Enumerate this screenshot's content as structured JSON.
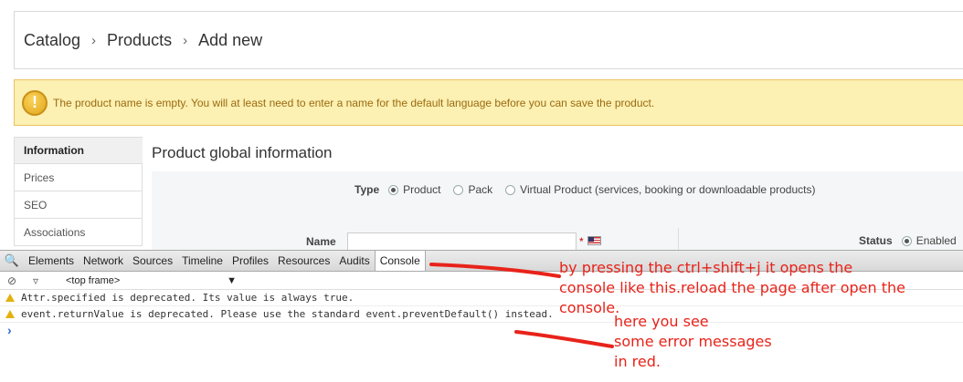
{
  "breadcrumb": {
    "items": [
      "Catalog",
      "Products",
      "Add new"
    ],
    "separator": "›"
  },
  "warning": {
    "message": "The product name is empty. You will at least need to enter a name for the default language before you can save the product.",
    "icon": "exclamation-circle-icon"
  },
  "tabs": [
    {
      "label": "Information",
      "active": true
    },
    {
      "label": "Prices",
      "active": false
    },
    {
      "label": "SEO",
      "active": false
    },
    {
      "label": "Associations",
      "active": false
    }
  ],
  "panel": {
    "title": "Product global information",
    "type_label": "Type",
    "type_options": [
      "Product",
      "Pack",
      "Virtual Product (services, booking or downloadable products)"
    ],
    "type_selected": "Product",
    "name_label": "Name",
    "name_value": "",
    "required_mark": "*",
    "status_label": "Status",
    "status_option": "Enabled"
  },
  "devtools": {
    "tabs": [
      "Elements",
      "Network",
      "Sources",
      "Timeline",
      "Profiles",
      "Resources",
      "Audits",
      "Console"
    ],
    "active_tab": "Console",
    "frame_selector": "<top frame>",
    "messages": [
      "Attr.specified is deprecated. Its value is always true.",
      "event.returnValue is deprecated. Please use the standard event.preventDefault() instead."
    ],
    "prompt": "›"
  },
  "annotations": {
    "console_note_line1": "by pressing the ctrl+shift+j it opens the",
    "console_note_line2": "console like this.reload the page after open the console.",
    "error_note_line1": "here you see",
    "error_note_line2": "some error messages",
    "error_note_line3": "in red."
  },
  "colors": {
    "warning_bg": "#fcf0b2",
    "warning_text": "#9a6b12",
    "annotation": "#e8231a",
    "console_prompt": "#2f6bd6"
  }
}
